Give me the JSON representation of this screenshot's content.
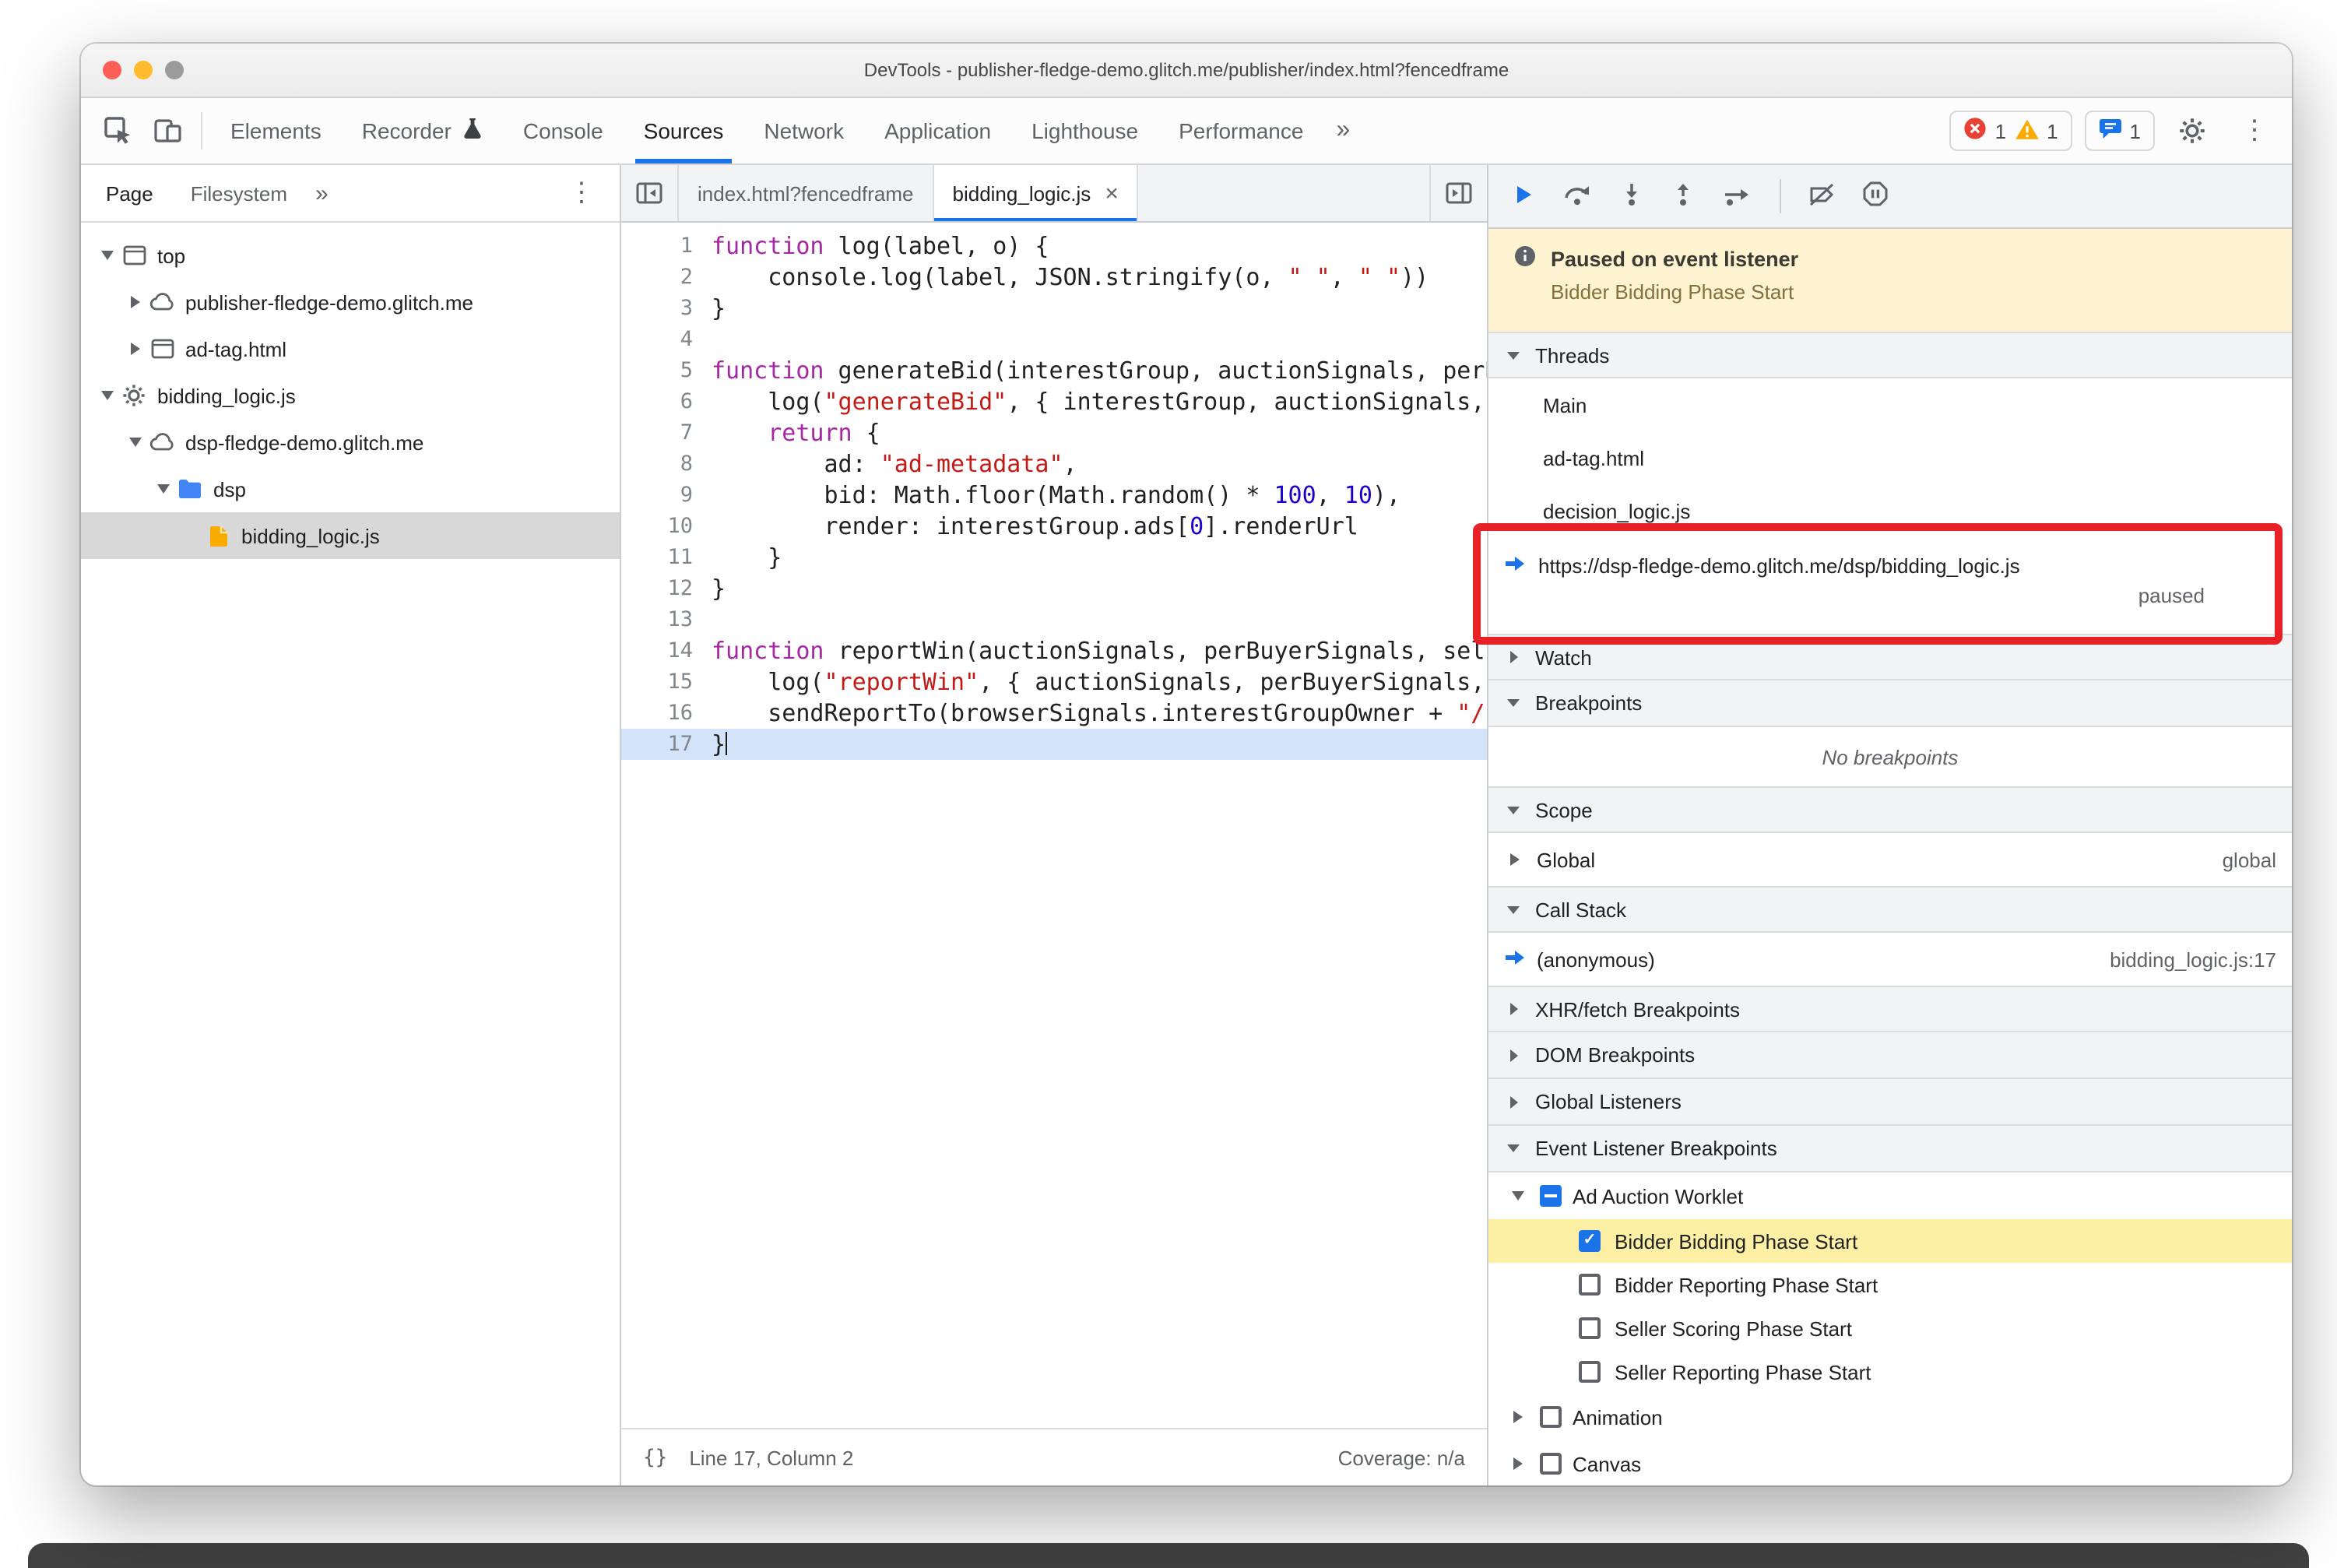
{
  "window": {
    "title": "DevTools - publisher-fledge-demo.glitch.me/publisher/index.html?fencedframe"
  },
  "icons": {
    "more": "»",
    "kebab": "⋮",
    "close": "×",
    "braces": "{}"
  },
  "colors": {
    "accent": "#1a73e8",
    "error": "#e94235",
    "warning": "#f9ab00",
    "annotation": "#e82127",
    "paused_line_bg": "#d3e4fa",
    "banner_bg": "#fdf3d1",
    "breakpoint_hit_bg": "#fdf0a4"
  },
  "toolbar": {
    "tabs": [
      {
        "label": "Elements"
      },
      {
        "label": "Recorder"
      },
      {
        "label": "Console"
      },
      {
        "label": "Sources"
      },
      {
        "label": "Network"
      },
      {
        "label": "Application"
      },
      {
        "label": "Lighthouse"
      },
      {
        "label": "Performance"
      }
    ],
    "selected": "Sources",
    "error_count": "1",
    "warning_count": "1",
    "issues_count": "1"
  },
  "navigator": {
    "tabs": [
      {
        "label": "Page"
      },
      {
        "label": "Filesystem"
      }
    ],
    "tree": [
      {
        "label": "top"
      },
      {
        "label": "publisher-fledge-demo.glitch.me"
      },
      {
        "label": "ad-tag.html"
      },
      {
        "label": "bidding_logic.js"
      },
      {
        "label": "dsp-fledge-demo.glitch.me"
      },
      {
        "label": "dsp"
      },
      {
        "label": "bidding_logic.js"
      }
    ]
  },
  "editor": {
    "tabs": [
      {
        "label": "index.html?fencedframe"
      },
      {
        "label": "bidding_logic.js"
      }
    ],
    "paused_line": 17,
    "status": {
      "line_col": "Line 17, Column 2",
      "coverage": "Coverage: n/a"
    },
    "lines": [
      [
        [
          "k",
          "function"
        ],
        [
          "p",
          " log(label, o) {"
        ]
      ],
      [
        [
          "p",
          "    console.log(label, JSON.stringify(o, "
        ],
        [
          "s",
          "\" \""
        ],
        [
          "p",
          ", "
        ],
        [
          "s",
          "\" \""
        ],
        [
          "p",
          "))"
        ]
      ],
      [
        [
          "p",
          "}"
        ]
      ],
      [],
      [
        [
          "k",
          "function"
        ],
        [
          "p",
          " generateBid(interestGroup, auctionSignals, perBuyerSignals, trustedBiddingSignals, browserSignals) {"
        ]
      ],
      [
        [
          "p",
          "    log("
        ],
        [
          "s",
          "\"generateBid\""
        ],
        [
          "p",
          ", { interestGroup, auctionSignals, perBuyerSignals, trustedBiddingSignals, browserSignals })"
        ]
      ],
      [
        [
          "p",
          "    "
        ],
        [
          "k",
          "return"
        ],
        [
          "p",
          " {"
        ]
      ],
      [
        [
          "p",
          "        ad: "
        ],
        [
          "s",
          "\"ad-metadata\""
        ],
        [
          "p",
          ","
        ]
      ],
      [
        [
          "p",
          "        bid: Math.floor(Math.random() * "
        ],
        [
          "n",
          "100"
        ],
        [
          "p",
          ", "
        ],
        [
          "n",
          "10"
        ],
        [
          "p",
          "),"
        ]
      ],
      [
        [
          "p",
          "        render: interestGroup.ads["
        ],
        [
          "n",
          "0"
        ],
        [
          "p",
          "].renderUrl"
        ]
      ],
      [
        [
          "p",
          "    }"
        ]
      ],
      [
        [
          "p",
          "}"
        ]
      ],
      [],
      [
        [
          "k",
          "function"
        ],
        [
          "p",
          " reportWin(auctionSignals, perBuyerSignals, sellerSignals, browserSignals) {"
        ]
      ],
      [
        [
          "p",
          "    log("
        ],
        [
          "s",
          "\"reportWin\""
        ],
        [
          "p",
          ", { auctionSignals, perBuyerSignals, sellerSignals, browserSignals })"
        ]
      ],
      [
        [
          "p",
          "    sendReportTo(browserSignals.interestGroupOwner + "
        ],
        [
          "s",
          "\"/report/bidder\""
        ],
        [
          "p",
          ")"
        ]
      ],
      [
        [
          "p",
          "}"
        ],
        [
          "caret",
          ""
        ]
      ]
    ]
  },
  "debugger": {
    "banner": {
      "title": "Paused on event listener",
      "subtitle": "Bidder Bidding Phase Start"
    },
    "threads": {
      "label": "Threads",
      "items": [
        "Main",
        "ad-tag.html",
        "decision_logic.js"
      ],
      "paused": {
        "url": "https://dsp-fledge-demo.glitch.me/dsp/bidding_logic.js",
        "status": "paused"
      }
    },
    "watch": {
      "label": "Watch"
    },
    "breakpoints": {
      "label": "Breakpoints",
      "empty": "No breakpoints"
    },
    "scope": {
      "label": "Scope",
      "items": [
        {
          "name": "Global",
          "hint": "global"
        }
      ]
    },
    "call_stack": {
      "label": "Call Stack",
      "frames": [
        {
          "name": "(anonymous)",
          "location": "bidding_logic.js:17"
        }
      ]
    },
    "xhr": {
      "label": "XHR/fetch Breakpoints"
    },
    "dom": {
      "label": "DOM Breakpoints"
    },
    "global_listeners": {
      "label": "Global Listeners"
    },
    "elb": {
      "label": "Event Listener Breakpoints",
      "groups": [
        {
          "label": "Ad Auction Worklet",
          "state": "indeterminate",
          "expanded": true,
          "children": [
            {
              "label": "Bidder Bidding Phase Start",
              "checked": true,
              "highlighted": true
            },
            {
              "label": "Bidder Reporting Phase Start",
              "checked": false
            },
            {
              "label": "Seller Scoring Phase Start",
              "checked": false
            },
            {
              "label": "Seller Reporting Phase Start",
              "checked": false
            }
          ]
        },
        {
          "label": "Animation",
          "state": "unchecked",
          "expanded": false
        },
        {
          "label": "Canvas",
          "state": "unchecked",
          "expanded": false
        }
      ]
    }
  }
}
